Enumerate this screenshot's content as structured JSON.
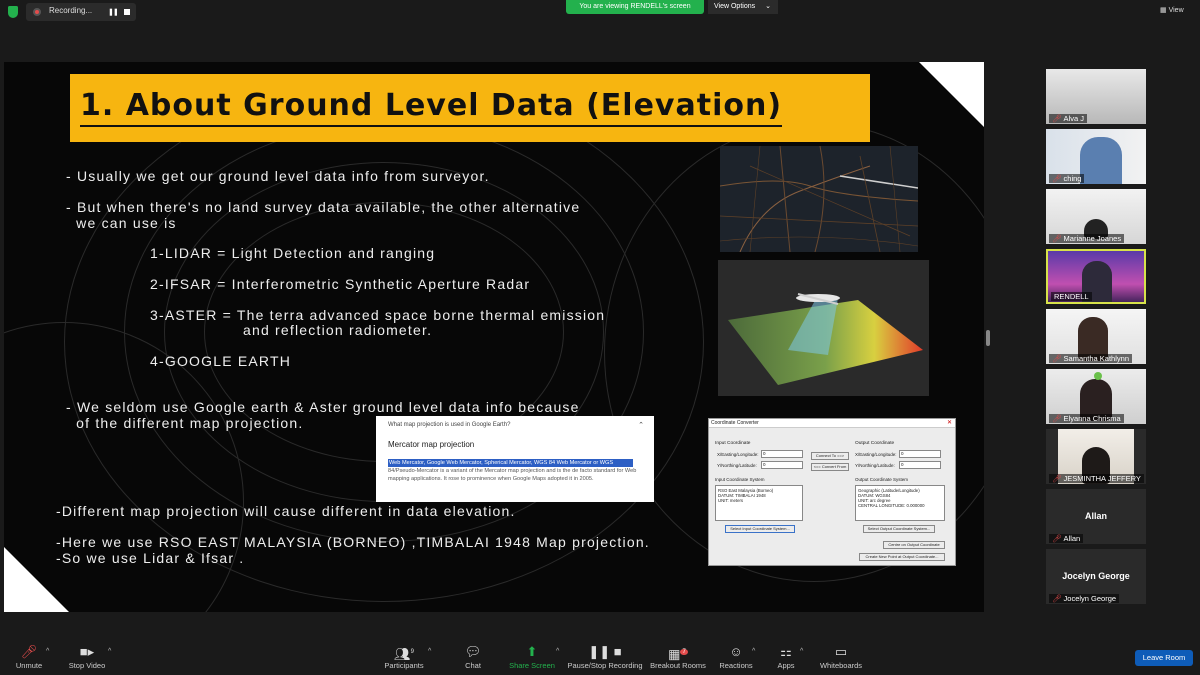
{
  "topbar": {
    "recording_label": "Recording...",
    "viewing_banner": "You are viewing RENDELL's screen",
    "view_options_label": "View Options",
    "view_label": "View"
  },
  "slide": {
    "title": "1. About Ground Level Data (Elevation)",
    "lines": [
      "- Usually we get our ground level data info from surveyor.",
      "- But when there's no land survey data available, the other alternative",
      "  we can use is",
      "1-LIDAR = Light Detection and ranging",
      "2-IFSAR = Interferometric Synthetic Aperture Radar",
      "3-ASTER = The terra advanced space borne thermal emission",
      "and reflection radiometer.",
      "4-GOOGLE EARTH",
      "- We seldom use Google earth & Aster ground level data info because",
      "  of the different map projection.",
      "-Different map projection will cause different in data elevation.",
      "-Here we use RSO EAST MALAYSIA (BORNEO) ,TIMBALAI 1948 Map projection.",
      "-So we use Lidar & Ifsar ."
    ],
    "google_box": {
      "question": "What map projection is used in Google Earth?",
      "answer_title": "Mercator map projection",
      "highlight": "Web Mercator, Google Web Mercator, Spherical Mercator, WGS 84 Web Mercator or WGS",
      "body": "84/Pseudo-Mercator is a variant of the Mercator map projection and is the de facto standard for Web mapping applications. It rose to prominence when Google Maps adopted it in 2005."
    },
    "coord_converter": {
      "window_title": "Coordinate Converter",
      "input_coord": "Input Coordinate",
      "output_coord": "Output Coordinate",
      "x_easting": "X/Easting/Longitude:",
      "y_northing": "Y/Northing/Latitude:",
      "x_value": "0",
      "y_value": "0",
      "connect_btn": "Connect To ==>",
      "convert_btn": "<== Convert From",
      "input_system_label": "Input Coordinate System",
      "input_system_text": "RSO East Malaysia (Borneo)\nDATUM: TIMBALAI 1948\nUNIT: meters",
      "output_system_label": "Output Coordinate System",
      "output_system_text": "Geographic (Latitude/Longitude)\nDATUM: WGS84\nUNIT: arc degree\nCENTRAL LONGITUDE:   0.000000",
      "select_input_btn": "Select Input Coordinate System...",
      "select_output_btn": "Select Output Coordinate System...",
      "center_btn": "Centre on Output Coordinate",
      "create_btn": "Create New Point at Output Coordinate..."
    }
  },
  "participants": [
    {
      "name": "Alva J",
      "muted": true
    },
    {
      "name": "ching",
      "muted": true
    },
    {
      "name": "Marianne Joanes",
      "muted": true
    },
    {
      "name": "RENDELL",
      "muted": false
    },
    {
      "name": "Samantha Kathlynn",
      "muted": true
    },
    {
      "name": "Elyanna Chrisma",
      "muted": true
    },
    {
      "name": "JESMINTHA JEFFERY",
      "muted": true
    },
    {
      "name": "Allan",
      "muted": true,
      "display": "Allan"
    },
    {
      "name": "Jocelyn George",
      "muted": true,
      "display": "Jocelyn George"
    }
  ],
  "toolbar": {
    "unmute": "Unmute",
    "stop_video": "Stop Video",
    "participants": "Participants",
    "participants_count": "9",
    "chat": "Chat",
    "share_screen": "Share Screen",
    "pause_recording": "Pause/Stop Recording",
    "breakout_rooms": "Breakout Rooms",
    "breakout_badge": "7",
    "reactions": "Reactions",
    "apps": "Apps",
    "whiteboards": "Whiteboards",
    "leave_room": "Leave Room"
  },
  "colors": {
    "accent_green": "#23b14d",
    "title_yellow": "#f7b510",
    "leave_blue": "#0e5cb8",
    "active_speaker": "#d7e24a"
  }
}
